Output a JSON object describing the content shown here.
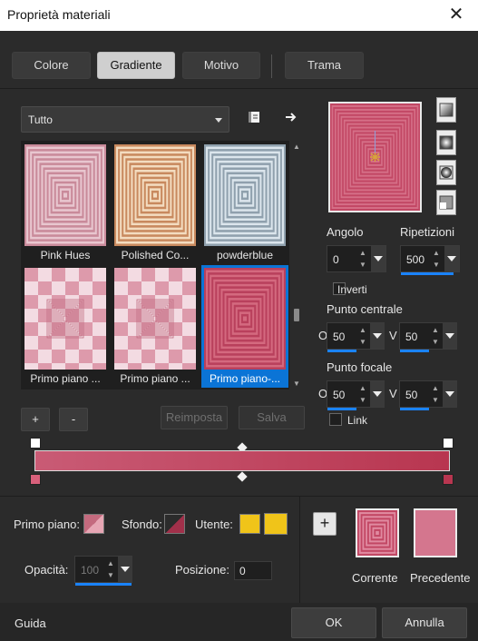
{
  "window": {
    "title": "Proprietà materiali",
    "close_icon": "close-icon"
  },
  "tabs": [
    {
      "label": "Colore",
      "active": false
    },
    {
      "label": "Gradiente",
      "active": true
    },
    {
      "label": "Motivo",
      "active": false
    },
    {
      "label": "Trama",
      "active": false
    }
  ],
  "category_select": {
    "value": "Tutto"
  },
  "gallery": {
    "items": [
      {
        "label": "Pink Hues",
        "colors": [
          "#c98a9a",
          "#e8c6cf"
        ],
        "style": "rect",
        "selected": false
      },
      {
        "label": "Polished Co...",
        "colors": [
          "#c8895e",
          "#f3dcc0"
        ],
        "style": "rect",
        "selected": false
      },
      {
        "label": "powderblue",
        "colors": [
          "#8fa0ad",
          "#dbe5ec"
        ],
        "style": "rect",
        "selected": false
      },
      {
        "label": "Primo piano ...",
        "colors": [
          "#c06b80",
          "#f3dbe2"
        ],
        "style": "checker",
        "selected": false
      },
      {
        "label": "Primo piano ...",
        "colors": [
          "#c06b80",
          "#f3dbe2"
        ],
        "style": "checker",
        "selected": false
      },
      {
        "label": "Primo piano-...",
        "colors": [
          "#b9405c",
          "#d4697f"
        ],
        "style": "rect",
        "selected": true
      }
    ]
  },
  "buttons": {
    "add": "+",
    "remove": "-",
    "reset": "Reimposta",
    "save": "Salva",
    "new_swatch": "+",
    "help": "Guida",
    "ok": "OK",
    "cancel": "Annulla"
  },
  "fields": {
    "angle": {
      "label": "Angolo",
      "value": "0"
    },
    "repeats": {
      "label": "Ripetizioni",
      "value": "500"
    },
    "invert": {
      "label": "Inverti",
      "checked": false
    },
    "center_point": {
      "label": "Punto centrale",
      "o_label": "O",
      "o_value": "50",
      "v_label": "V",
      "v_value": "50"
    },
    "focal_point": {
      "label": "Punto focale",
      "o_label": "O",
      "o_value": "50",
      "v_label": "V",
      "v_value": "50"
    },
    "link": {
      "label": "Link",
      "checked": false
    }
  },
  "gradient": {
    "start_color": "#c95b75",
    "end_color": "#b83650",
    "midpoint": 50
  },
  "materials": {
    "foreground_label": "Primo piano:",
    "background_label": "Sfondo:",
    "user_label": "Utente:",
    "user_color": "#f0c419",
    "opacity_label": "Opacità:",
    "opacity_value": "100",
    "position_label": "Posizione:",
    "position_value": "0",
    "current_label": "Corrente",
    "previous_label": "Precedente",
    "previous_color": "#d4768e"
  }
}
